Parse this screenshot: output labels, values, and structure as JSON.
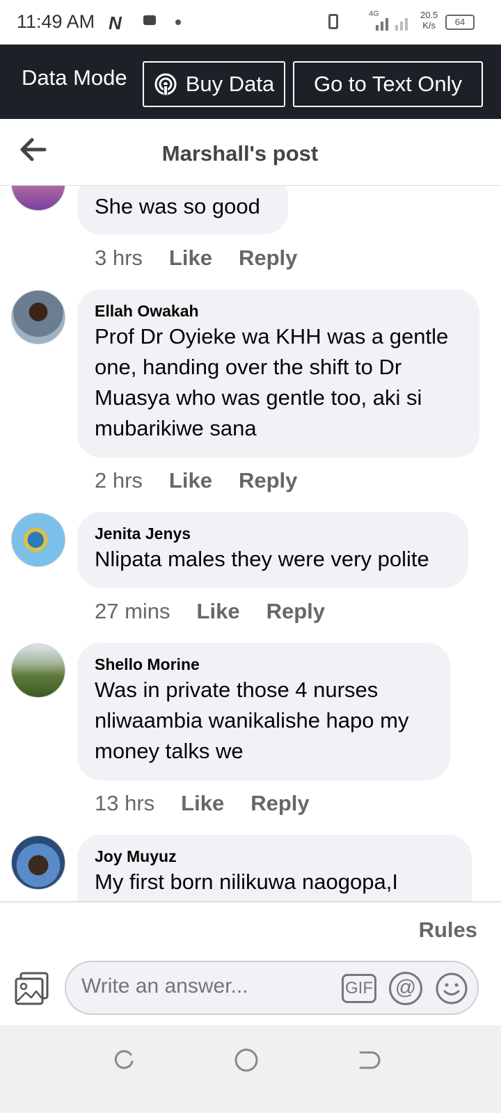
{
  "status_bar": {
    "time": "11:49 AM",
    "network_type": "4G",
    "speed_value": "20.5",
    "speed_unit": "K/s",
    "battery": "64"
  },
  "data_bar": {
    "mode_label": "Data Mode",
    "buy_data_label": "Buy Data",
    "text_only_label": "Go to Text Only"
  },
  "header": {
    "title": "Marshall's post"
  },
  "comments": [
    {
      "author": "",
      "text": "She was so good",
      "time": "3 hrs",
      "like": "Like",
      "reply": "Reply"
    },
    {
      "author": "Ellah Owakah",
      "text": "Prof Dr Oyieke wa KHH was a gentle one, handing over the shift to Dr Muasya who was gentle too, aki si mubarikiwe sana",
      "time": "2 hrs",
      "like": "Like",
      "reply": "Reply"
    },
    {
      "author": "Jenita Jenys",
      "text": "Nlipata males they were very polite",
      "time": "27 mins",
      "like": "Like",
      "reply": "Reply"
    },
    {
      "author": "Shello Morine",
      "text": "Was in private those 4 nurses nliwaambia wanikalishe hapo my money talks we",
      "time": "13 hrs",
      "like": "Like",
      "reply": "Reply"
    },
    {
      "author": "Joy Muyuz",
      "text": "My first born nilikuwa naogopa,I",
      "time": "",
      "like": "",
      "reply": ""
    }
  ],
  "footer": {
    "rules_label": "Rules",
    "answer_placeholder": "Write an answer...",
    "gif_label": "GIF",
    "at_label": "@"
  },
  "icons": {
    "back": "back-arrow-icon",
    "buy_data": "broadcast-icon",
    "photo": "photo-icon",
    "gif": "gif-icon",
    "mention": "at-icon",
    "emoji": "emoji-icon"
  }
}
